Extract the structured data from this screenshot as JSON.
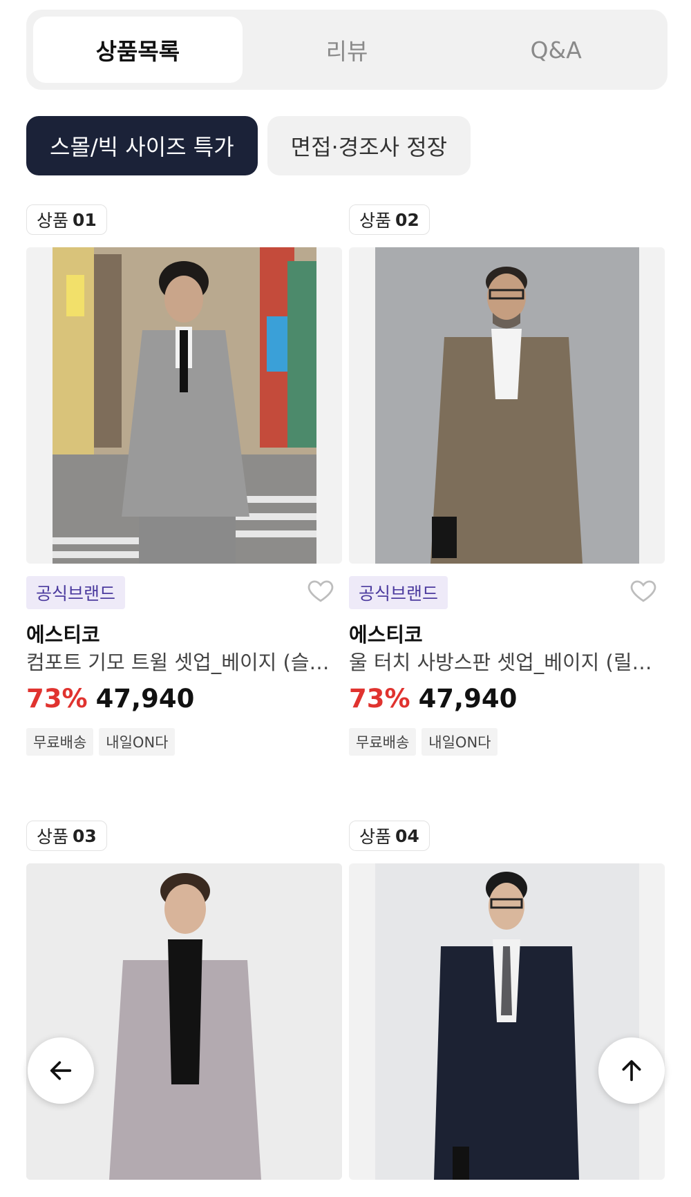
{
  "tabs": [
    {
      "label": "상품목록",
      "active": true
    },
    {
      "label": "리뷰",
      "active": false
    },
    {
      "label": "Q&A",
      "active": false
    }
  ],
  "chips": [
    {
      "label": "스몰/빅 사이즈 특가",
      "active": true
    },
    {
      "label": "면접·경조사 정장",
      "active": false
    }
  ],
  "products": [
    {
      "badge_prefix": "상품",
      "badge_num": "01",
      "brand_tag": "공식브랜드",
      "brand": "에스티코",
      "name": "컴포트 기모 트윌 셋업_베이지 (슬…",
      "discount": "73%",
      "price": "47,940",
      "tags": [
        "무료배송",
        "내일ON다"
      ]
    },
    {
      "badge_prefix": "상품",
      "badge_num": "02",
      "brand_tag": "공식브랜드",
      "brand": "에스티코",
      "name": "울 터치 사방스판 셋업_베이지 (릴…",
      "discount": "73%",
      "price": "47,940",
      "tags": [
        "무료배송",
        "내일ON다"
      ]
    },
    {
      "badge_prefix": "상품",
      "badge_num": "03"
    },
    {
      "badge_prefix": "상품",
      "badge_num": "04"
    }
  ],
  "icons": {
    "heart": "heart-outline-icon",
    "back": "arrow-left-icon",
    "top": "arrow-up-icon"
  },
  "colors": {
    "accent_dark": "#1b2238",
    "discount_red": "#e0332f",
    "brand_tag_bg": "#eeeaf8",
    "brand_tag_text": "#4b3a9e"
  }
}
